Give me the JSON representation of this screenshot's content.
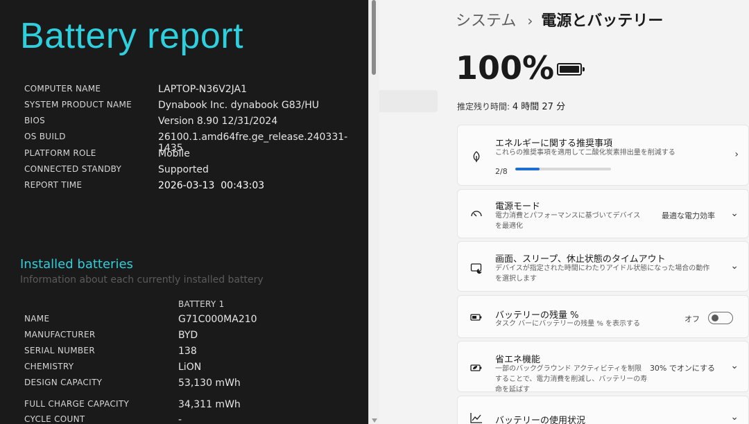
{
  "report": {
    "title": "Battery report",
    "system_info": [
      {
        "label": "COMPUTER NAME",
        "value": "LAPTOP-N36V2JA1"
      },
      {
        "label": "SYSTEM PRODUCT NAME",
        "value": "Dynabook Inc. dynabook G83/HU"
      },
      {
        "label": "BIOS",
        "value": "Version 8.90 12/31/2024"
      },
      {
        "label": "OS BUILD",
        "value": "26100.1.amd64fre.ge_release.240331-1435"
      },
      {
        "label": "PLATFORM ROLE",
        "value": "Mobile"
      },
      {
        "label": "CONNECTED STANDBY",
        "value": "Supported"
      },
      {
        "label": "REPORT TIME",
        "value": "2026-03-13  00:43:03"
      }
    ],
    "installed": {
      "title": "Installed batteries",
      "subtitle": "Information about each currently installed battery",
      "column_header": "BATTERY 1",
      "rows": [
        {
          "label": "NAME",
          "value": "G71C000MA210"
        },
        {
          "label": "MANUFACTURER",
          "value": "BYD"
        },
        {
          "label": "SERIAL NUMBER",
          "value": "138"
        },
        {
          "label": "CHEMISTRY",
          "value": "LiON"
        },
        {
          "label": "DESIGN CAPACITY",
          "value": "53,130 mWh"
        },
        {
          "label": "FULL CHARGE CAPACITY",
          "value": "34,311 mWh"
        },
        {
          "label": "CYCLE COUNT",
          "value": "-"
        }
      ]
    }
  },
  "settings": {
    "breadcrumb": {
      "parent": "システム",
      "separator": "›",
      "current": "電源とバッテリー"
    },
    "battery_percent": "100%",
    "battery_level": 1.0,
    "remaining": {
      "label": "推定残り時間:",
      "value": "4 時間 27 分"
    },
    "cards": [
      {
        "title": "エネルギーに関する推奨事項",
        "subtitle": "これらの推奨事項を適用して二酸化炭素排出量を削減する",
        "progress_text": "2/8",
        "progress": 0.25,
        "icon": "leaf-icon"
      },
      {
        "title": "電源モード",
        "subtitle": "電力消費とパフォーマンスに基づいてデバイスを最適化",
        "value": "最適な電力効率",
        "icon": "gauge-icon"
      },
      {
        "title": "画面、スリープ、休止状態のタイムアウト",
        "subtitle": "デバイスが指定された時間にわたりアイドル状態になった場合の動作を選択します",
        "icon": "screen-sleep-icon"
      },
      {
        "title": "バッテリーの残量 %",
        "subtitle": "タスク バーにバッテリーの残量 % を表示する",
        "value": "オフ",
        "icon": "battery-percent-icon"
      },
      {
        "title": "省エネ機能",
        "subtitle": "一部のバックグラウンド アクティビティを制限することで、電力消費を削減し、バッテリーの寿命を延ばす",
        "value": "30% でオンにする",
        "icon": "battery-saver-icon"
      },
      {
        "title": "バッテリーの使用状況",
        "icon": "usage-chart-icon"
      }
    ],
    "colors": {
      "accent": "#1f6fd1",
      "report_heading": "#2fd0dd"
    }
  }
}
